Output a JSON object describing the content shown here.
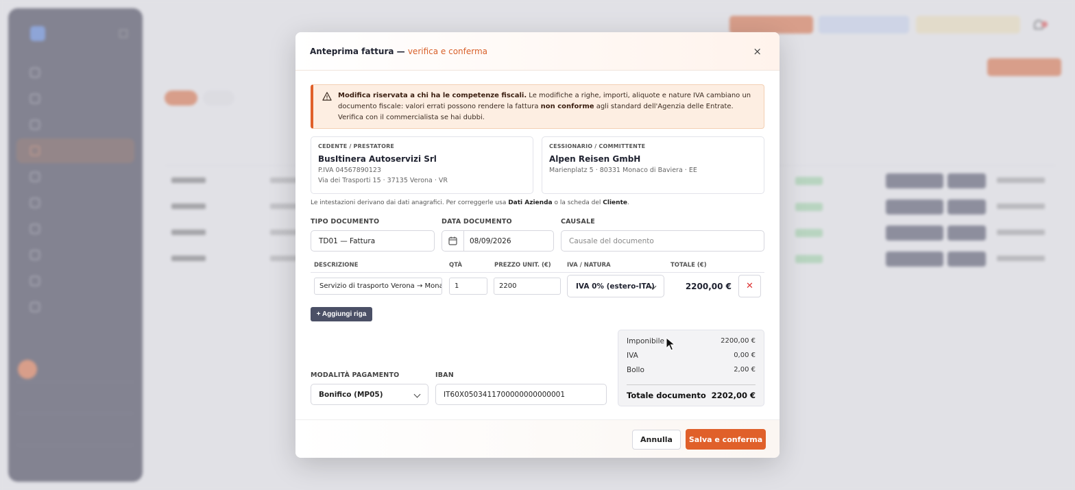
{
  "modal": {
    "title": "Anteprima fattura — ",
    "title_accent": "verifica e conferma",
    "close": "×",
    "warning": {
      "bold1": "Modifica riservata a chi ha le competenze fiscali.",
      "text1": " Le modifiche a righe, importi, aliquote e nature IVA cambiano un documento fiscale: valori errati possono rendere la fattura ",
      "bold2": "non conforme",
      "text2": " agli standard dell'Agenzia delle Entrate. Verifica con il commercialista se hai dubbi."
    },
    "seller": {
      "label": "CEDENTE / PRESTATORE",
      "name": "BusItinera Autoservizi Srl",
      "vat": "P.IVA 04567890123",
      "address": "Via dei Trasporti 15 · 37135 Verona · VR"
    },
    "buyer": {
      "label": "CESSIONARIO / COMMITTENTE",
      "name": "Alpen Reisen GmbH",
      "address": "Marienplatz 5 · 80331 Monaco di Baviera · EE"
    },
    "hint": {
      "pre": "Le intestazioni derivano dai dati anagrafici. Per correggerle usa ",
      "link1": "Dati Azienda",
      "mid": " o la scheda del ",
      "link2": "Cliente",
      "post": "."
    },
    "doc_type": {
      "label": "TIPO DOCUMENTO",
      "value": "TD01 — Fattura"
    },
    "doc_date": {
      "label": "DATA DOCUMENTO",
      "value": "08/09/2026"
    },
    "reason": {
      "label": "CAUSALE",
      "placeholder": "Causale del documento"
    },
    "lines": {
      "headers": [
        "DESCRIZIONE",
        "QTÀ",
        "PREZZO UNIT. (€)",
        "IVA / NATURA",
        "TOTALE (€)"
      ],
      "rows": [
        {
          "description": "Servizio di trasporto Verona → Monaco",
          "qty": "1",
          "price": "2200",
          "vat": "IVA 0% (estero-ITA)",
          "total": "2200,00 €",
          "delete": "✕"
        }
      ],
      "add_label": "+ Aggiungi riga"
    },
    "payment": {
      "label": "MODALITÀ PAGAMENTO",
      "value": "Bonifico (MP05)"
    },
    "iban": {
      "label": "IBAN",
      "value": "IT60X0503411700000000000001"
    },
    "summary": {
      "taxable_label": "Imponibile",
      "taxable": "2200,00 €",
      "vat_label": "IVA",
      "vat": "0,00 €",
      "stamp_label": "Bollo",
      "stamp": "2,00 €",
      "total_label": "Totale documento",
      "total": "2202,00 €"
    },
    "cancel": "Annulla",
    "save": "Salva e conferma"
  },
  "colors": {
    "accent": "#e0602a",
    "sidebar": "#24243a",
    "warning_bg": "#fdeee2"
  }
}
